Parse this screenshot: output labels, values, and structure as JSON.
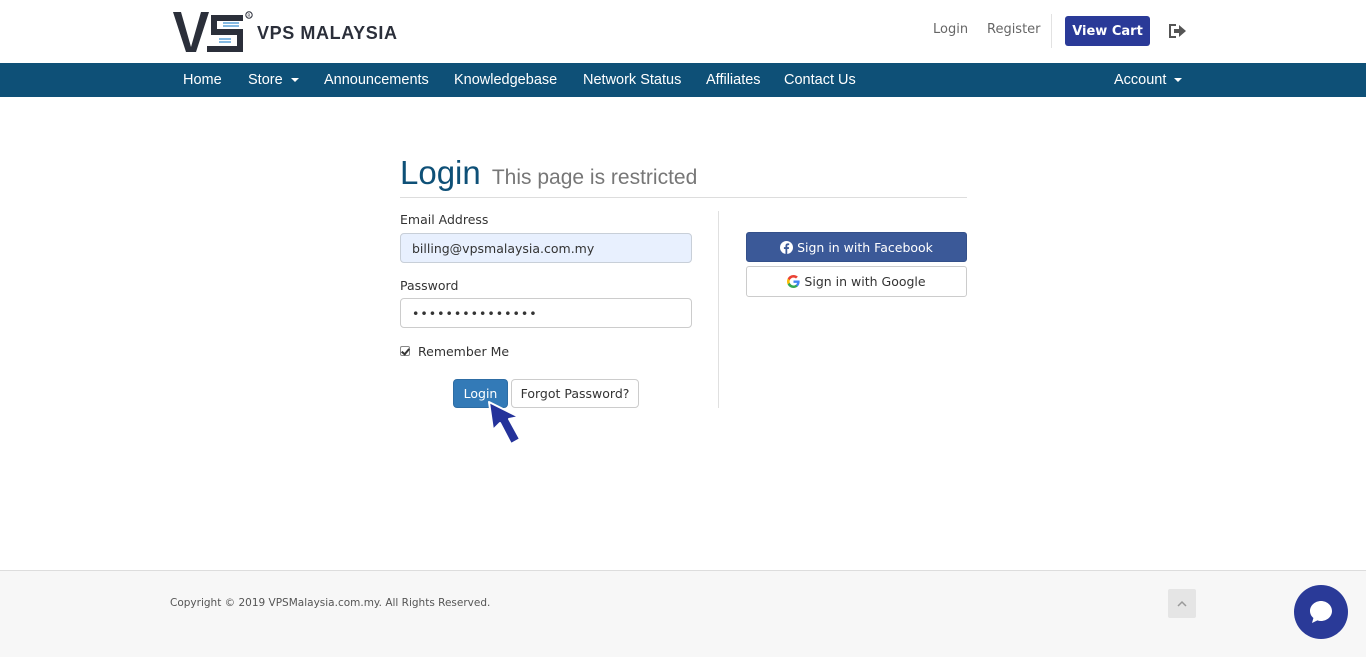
{
  "header": {
    "brand": "VPS MALAYSIA",
    "login_link": "Login",
    "register_link": "Register",
    "view_cart": "View Cart"
  },
  "nav": {
    "items": [
      "Home",
      "Store",
      "Announcements",
      "Knowledgebase",
      "Network Status",
      "Affiliates",
      "Contact Us"
    ],
    "account": "Account"
  },
  "page": {
    "title": "Login",
    "subtitle": "This page is restricted"
  },
  "form": {
    "email_label": "Email Address",
    "email_value": "billing@vpsmalaysia.com.my",
    "password_label": "Password",
    "password_value": "•••••••••••••••",
    "remember_label": "Remember Me",
    "remember_checked": true,
    "login_button": "Login",
    "forgot_button": "Forgot Password?"
  },
  "social": {
    "facebook": "Sign in with Facebook",
    "google": "Sign in with Google"
  },
  "footer": {
    "copyright": "Copyright © 2019 VPSMalaysia.com.my. All Rights Reserved."
  },
  "colors": {
    "nav_bg": "#0e5077",
    "accent": "#2a3a98",
    "login_button": "#337ab7",
    "facebook": "#3b5998"
  },
  "icons": [
    "logout-icon",
    "caret-down-icon",
    "facebook-icon",
    "google-icon",
    "chevron-up-icon",
    "chat-icon",
    "mouse-cursor"
  ]
}
